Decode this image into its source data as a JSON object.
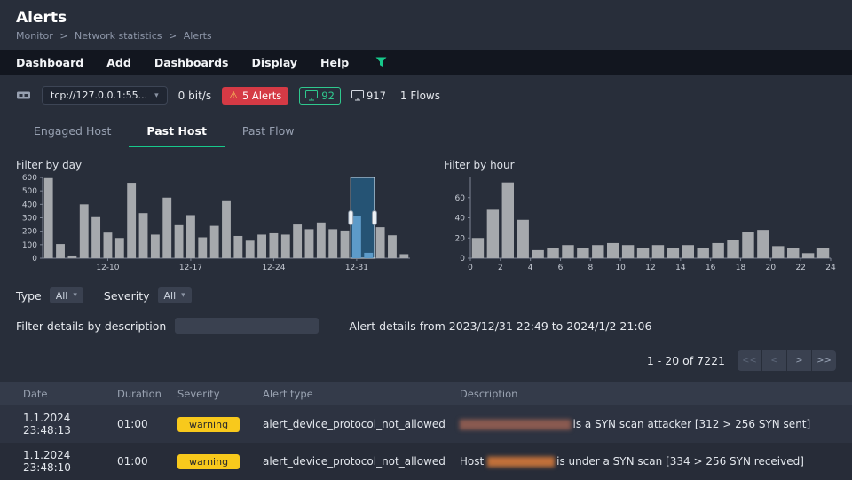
{
  "header": {
    "title": "Alerts",
    "breadcrumb": {
      "items": [
        "Monitor",
        "Network statistics",
        "Alerts"
      ],
      "separator": ">"
    }
  },
  "menubar": {
    "items": [
      "Dashboard",
      "Add",
      "Dashboards",
      "Display",
      "Help"
    ]
  },
  "icons": {
    "caret_down": "▾",
    "warning": "⚠"
  },
  "statusbar": {
    "interface": "tcp://127.0.0.1:55...",
    "throughput": "0 bit/s",
    "alerts_badge": "5 Alerts",
    "hosts_badge": "92",
    "devices_count": "917",
    "flows": "1 Flows"
  },
  "tabs": [
    {
      "label": "Engaged Host",
      "active": false
    },
    {
      "label": "Past Host",
      "active": true
    },
    {
      "label": "Past Flow",
      "active": false
    }
  ],
  "filters": {
    "type_label": "Type",
    "type_value": "All",
    "severity_label": "Severity",
    "severity_value": "All"
  },
  "description_filter": {
    "label": "Filter details by description",
    "value": "",
    "range_text": "Alert details from 2023/12/31 22:49 to 2024/1/2 21:06"
  },
  "pagination": {
    "range_text": "1 - 20 of 7221",
    "buttons": [
      "<<",
      "<",
      ">",
      ">>"
    ]
  },
  "table": {
    "headers": [
      "Date",
      "Duration",
      "Severity",
      "Alert type",
      "Description"
    ],
    "rows": [
      {
        "date": "1.1.2024 23:48:13",
        "duration": "01:00",
        "severity": "warning",
        "alert_type": "alert_device_protocol_not_allowed",
        "desc_prefix": "",
        "desc_redacted": "████████████████████",
        "desc_suffix": " is a SYN scan attacker [312 > 256 SYN sent]"
      },
      {
        "date": "1.1.2024 23:48:10",
        "duration": "01:00",
        "severity": "warning",
        "alert_type": "alert_device_protocol_not_allowed",
        "desc_prefix": "Host ",
        "desc_redacted": "████████████",
        "desc_suffix": " is under a SYN scan [334 > 256 SYN received]"
      }
    ]
  },
  "chart_data": [
    {
      "type": "bar",
      "title": "Filter by day",
      "xlabel": "",
      "ylabel": "",
      "ylim": [
        0,
        600
      ],
      "yticks": [
        0,
        100,
        200,
        300,
        400,
        500,
        600
      ],
      "values": [
        595,
        105,
        20,
        400,
        305,
        190,
        150,
        560,
        335,
        175,
        450,
        245,
        320,
        155,
        240,
        430,
        165,
        130,
        175,
        185,
        175,
        250,
        215,
        265,
        215,
        205,
        310,
        40,
        230,
        170,
        30
      ],
      "xticks": [
        {
          "i": 5,
          "label": "12-10"
        },
        {
          "i": 12,
          "label": "12-17"
        },
        {
          "i": 19,
          "label": "12-24"
        },
        {
          "i": 26,
          "label": "12-31"
        }
      ],
      "tick_align": "center",
      "selection": {
        "start": 26,
        "end": 27
      },
      "bar_color": "#a6a9ad",
      "selected_bar_color": "#5d9bc9",
      "selection_fill": "#24597f",
      "grid": false,
      "legend": false
    },
    {
      "type": "bar",
      "title": "Filter by hour",
      "xlabel": "",
      "ylabel": "",
      "ylim": [
        0,
        80
      ],
      "yticks": [
        0,
        20,
        40,
        60
      ],
      "values": [
        20,
        48,
        75,
        38,
        8,
        10,
        13,
        10,
        13,
        15,
        13,
        10,
        13,
        10,
        13,
        10,
        15,
        18,
        26,
        28,
        12,
        10,
        5,
        10
      ],
      "xticks": [
        {
          "i": 0,
          "label": "0"
        },
        {
          "i": 2,
          "label": "2"
        },
        {
          "i": 4,
          "label": "4"
        },
        {
          "i": 6,
          "label": "6"
        },
        {
          "i": 8,
          "label": "8"
        },
        {
          "i": 10,
          "label": "10"
        },
        {
          "i": 12,
          "label": "12"
        },
        {
          "i": 14,
          "label": "14"
        },
        {
          "i": 16,
          "label": "16"
        },
        {
          "i": 18,
          "label": "18"
        },
        {
          "i": 20,
          "label": "20"
        },
        {
          "i": 22,
          "label": "22"
        },
        {
          "i": 24,
          "label": "24"
        }
      ],
      "tick_align": "edge",
      "bar_color": "#a6a9ad",
      "grid": false,
      "legend": false
    }
  ],
  "colors": {
    "accent_green": "#17c98b",
    "alert_red": "#d53a45",
    "warning_yellow": "#f8c91c",
    "bar_gray": "#a6a9ad",
    "selection_blue": "#24597f"
  }
}
